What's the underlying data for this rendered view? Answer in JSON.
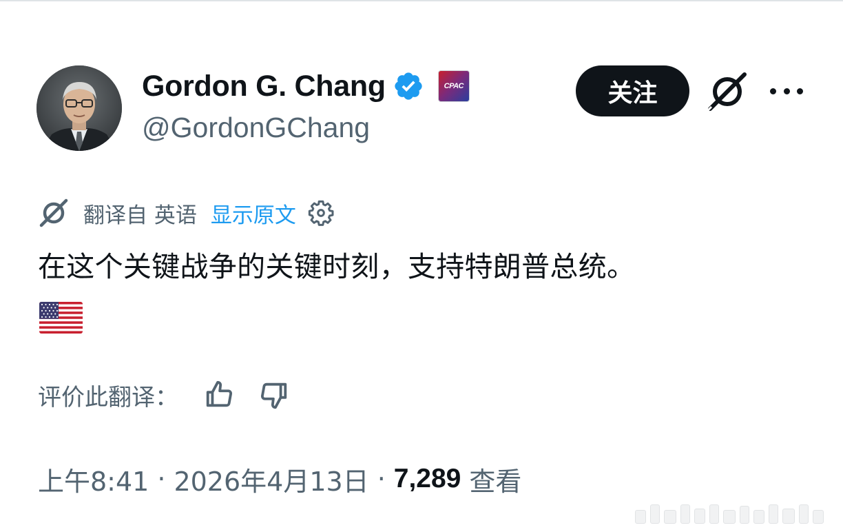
{
  "author": {
    "display_name": "Gordon G. Chang",
    "handle": "@GordonGChang",
    "verified_badge_color": "#1d9bf0",
    "affiliate_badge_text": "CPAC"
  },
  "actions": {
    "follow_label": "关注",
    "grok_icon": "grok-icon",
    "more_icon": "more-icon"
  },
  "translation": {
    "translated_from": "翻译自 英语",
    "show_original": "显示原文",
    "accent_color": "#1d9bf0"
  },
  "tweet": {
    "text": "在这个关键战争的关键时刻，支持特朗普总统。",
    "emoji": "us-flag"
  },
  "rating": {
    "label": "评价此翻译："
  },
  "meta": {
    "time": "上午8:41",
    "separator": "·",
    "date": "2026年4月13日",
    "views_count": "7,289",
    "views_label": "查看"
  }
}
